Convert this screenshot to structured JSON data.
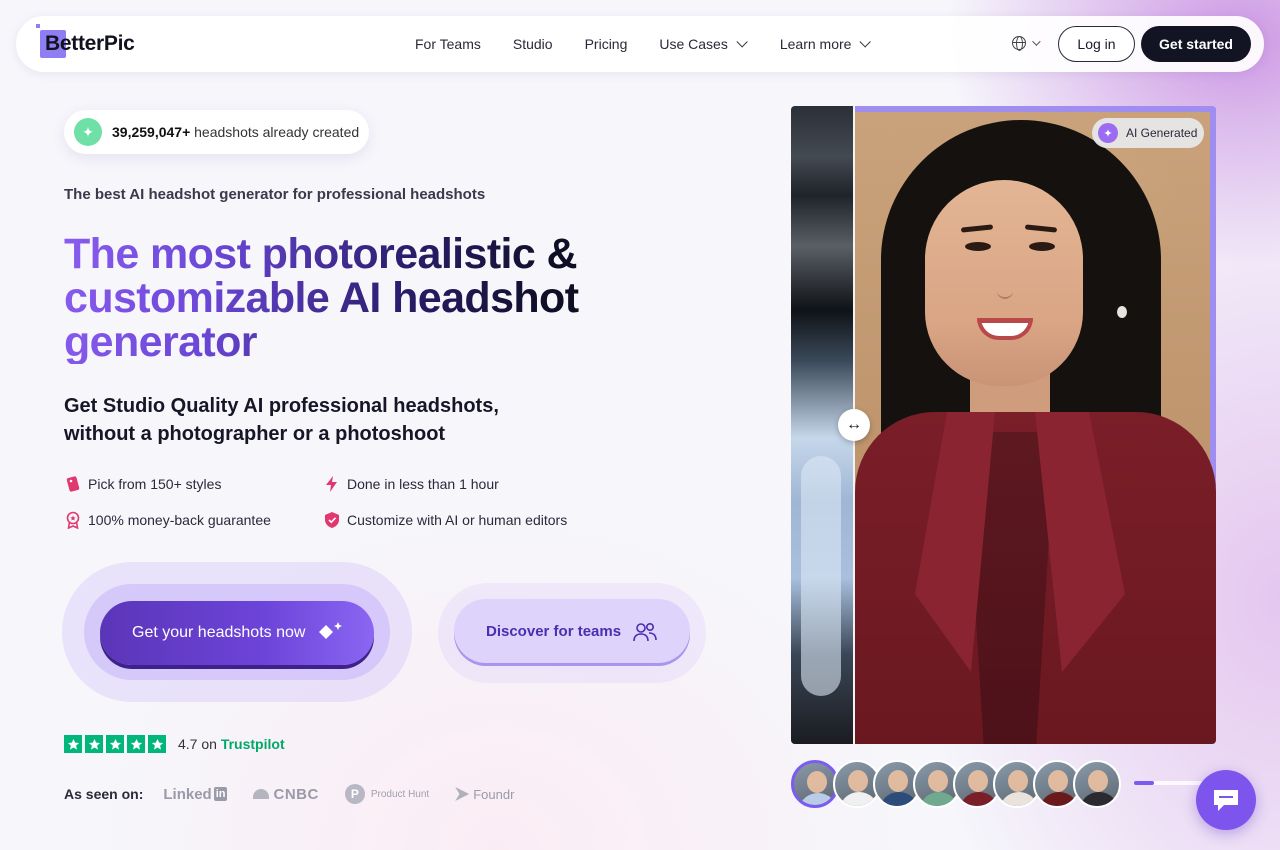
{
  "nav": {
    "logo": "BetterPic",
    "links": [
      {
        "label": "For Teams",
        "has_menu": false
      },
      {
        "label": "Studio",
        "has_menu": false
      },
      {
        "label": "Pricing",
        "has_menu": false
      },
      {
        "label": "Use Cases",
        "has_menu": true
      },
      {
        "label": "Learn more",
        "has_menu": true
      }
    ],
    "language_icon": "globe-icon",
    "login_label": "Log in",
    "start_label": "Get started"
  },
  "hero": {
    "badge_count": "39,259,047+",
    "badge_text": "headshots already created",
    "eyebrow": "The best AI headshot generator for professional headshots",
    "headline": "The most photorealistic & customizable AI headshot generator",
    "subhead_line1": "Get Studio Quality AI professional headshots,",
    "subhead_line2": "without a photographer or a photoshoot",
    "features": [
      {
        "label": "Pick from 150+ styles",
        "icon": "tag-icon"
      },
      {
        "label": "Done in less than 1 hour",
        "icon": "lightning-icon"
      },
      {
        "label": "100% money-back guarantee",
        "icon": "medal-icon"
      },
      {
        "label": "Customize with AI or human editors",
        "icon": "shield-icon"
      }
    ],
    "cta_primary": "Get your headshots now",
    "cta_secondary": "Discover for teams",
    "rating": "4.7",
    "rating_on": "on",
    "rating_source": "Trustpilot",
    "stars": 5,
    "seen_label": "As seen on:",
    "media": [
      "Linked",
      "in",
      "CNBC",
      "P",
      "Product Hunt",
      "Foundr"
    ]
  },
  "showcase": {
    "ai_label": "AI Generated",
    "slider_glyph": "↔",
    "thumbnails_count": 8,
    "carousel_progress": 0.28
  },
  "colors": {
    "accent": "#7b5cf0",
    "primary_button": "#5b35b8",
    "trustpilot": "#00b67a",
    "nav_dark": "#121423"
  }
}
